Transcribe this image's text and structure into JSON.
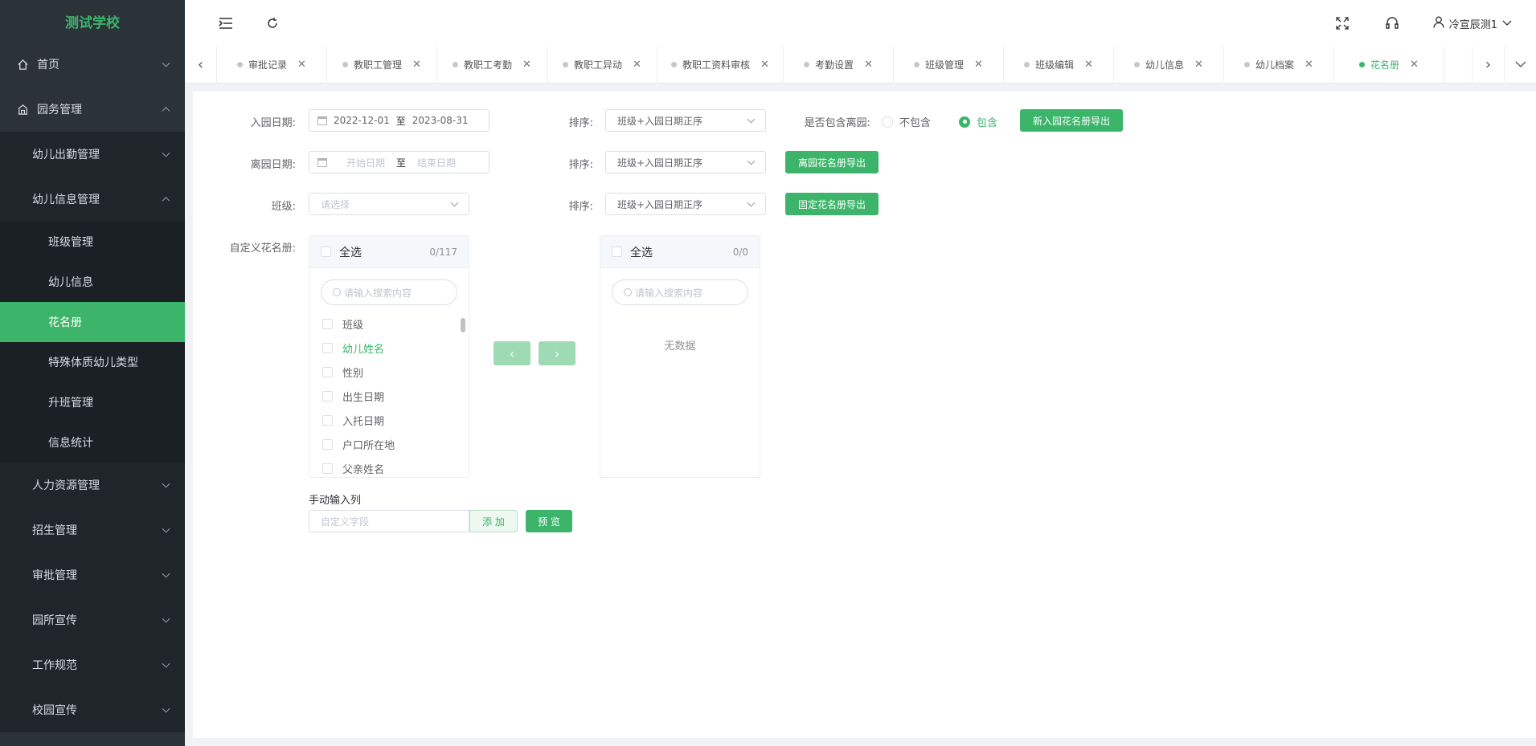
{
  "app": {
    "school_name": "测试学校"
  },
  "sidebar": {
    "items": [
      {
        "label": "首页",
        "icon": "home-icon",
        "expanded": false
      },
      {
        "label": "园务管理",
        "icon": "building-icon",
        "expanded": true
      },
      {
        "label": "幼儿出勤管理",
        "expanded": false
      },
      {
        "label": "幼儿信息管理",
        "expanded": true
      },
      {
        "label": "班级管理"
      },
      {
        "label": "幼儿信息"
      },
      {
        "label": "花名册",
        "active": true
      },
      {
        "label": "特殊体质幼儿类型"
      },
      {
        "label": "升班管理"
      },
      {
        "label": "信息统计"
      },
      {
        "label": "人力资源管理",
        "expanded": false
      },
      {
        "label": "招生管理",
        "expanded": false
      },
      {
        "label": "审批管理",
        "expanded": false
      },
      {
        "label": "园所宣传",
        "expanded": false
      },
      {
        "label": "工作规范",
        "expanded": false
      },
      {
        "label": "校园宣传",
        "expanded": false
      }
    ]
  },
  "header": {
    "user_name": "冷宣辰测1",
    "icons": [
      "menu-fold-icon",
      "refresh-icon",
      "fullscreen-icon",
      "headset-icon",
      "user-icon"
    ]
  },
  "tabs": [
    {
      "label": "审批记录"
    },
    {
      "label": "教职工管理"
    },
    {
      "label": "教职工考勤"
    },
    {
      "label": "教职工异动"
    },
    {
      "label": "教职工资料审核"
    },
    {
      "label": "考勤设置"
    },
    {
      "label": "班级管理"
    },
    {
      "label": "班级编辑"
    },
    {
      "label": "幼儿信息"
    },
    {
      "label": "幼儿档案"
    },
    {
      "label": "花名册",
      "active": true
    }
  ],
  "form": {
    "enroll_date_label": "入园日期:",
    "enroll_start": "2022-12-01",
    "enroll_end": "2023-08-31",
    "range_sep": "至",
    "sort_label": "排序:",
    "sort_value": "班级+入园日期正序",
    "include_leave_label": "是否包含离园:",
    "radio_exclude": "不包含",
    "radio_include": "包含",
    "export_new_btn": "新入园花名册导出",
    "leave_date_label": "离园日期:",
    "leave_start_ph": "开始日期",
    "leave_end_ph": "结束日期",
    "export_leave_btn": "离园花名册导出",
    "class_label": "班级:",
    "class_ph": "请选择",
    "export_fixed_btn": "固定花名册导出",
    "custom_label": "自定义花名册:",
    "manual_label": "手动输入列",
    "manual_ph": "自定义字段",
    "add_btn": "添 加",
    "preview_btn": "预 览"
  },
  "transfer": {
    "left": {
      "select_all": "全选",
      "count": "0/117",
      "search_ph": "请输入搜索内容",
      "items": [
        "班级",
        "幼儿姓名",
        "性别",
        "出生日期",
        "入托日期",
        "户口所在地",
        "父亲姓名"
      ]
    },
    "right": {
      "select_all": "全选",
      "count": "0/0",
      "search_ph": "请输入搜索内容",
      "empty": "无数据"
    }
  },
  "colors": {
    "accent": "#3cb56a",
    "sidebar_bg": "#2b3238"
  }
}
